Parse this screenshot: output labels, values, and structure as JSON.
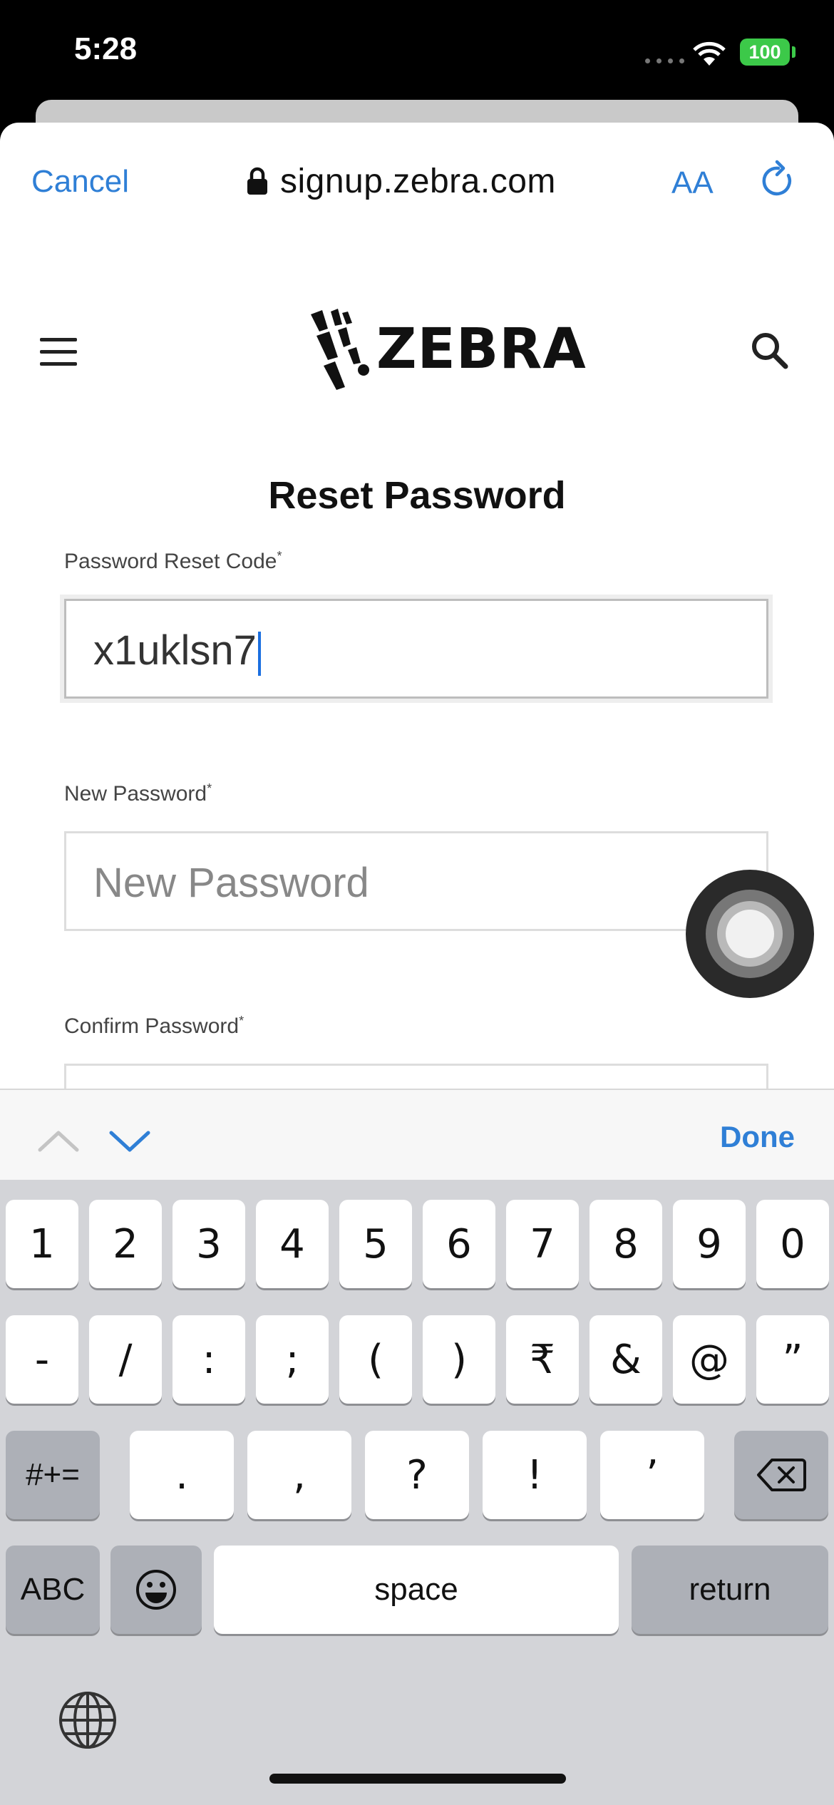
{
  "status_bar": {
    "time": "5:28",
    "battery": "100"
  },
  "browser": {
    "cancel": "Cancel",
    "domain": "signup.zebra.com",
    "text_size": "AA"
  },
  "brand": {
    "logo_text": "ZEBRA"
  },
  "page": {
    "title": "Reset Password"
  },
  "form": {
    "reset_code": {
      "label": "Password Reset Code",
      "required": "*",
      "value": "x1uklsn7"
    },
    "new_password": {
      "label": "New Password",
      "required": "*",
      "placeholder": "New Password"
    },
    "confirm_password": {
      "label": "Confirm Password",
      "required": "*"
    }
  },
  "accessory": {
    "done": "Done"
  },
  "keyboard": {
    "row1": [
      "1",
      "2",
      "3",
      "4",
      "5",
      "6",
      "7",
      "8",
      "9",
      "0"
    ],
    "row2": [
      "-",
      "/",
      ":",
      ";",
      "(",
      ")",
      "₹",
      "&",
      "@",
      "”"
    ],
    "row3": [
      ".",
      ",",
      "?",
      "!",
      "’"
    ],
    "mode_key": "#+=",
    "abc_key": "ABC",
    "space": "space",
    "return": "return"
  }
}
